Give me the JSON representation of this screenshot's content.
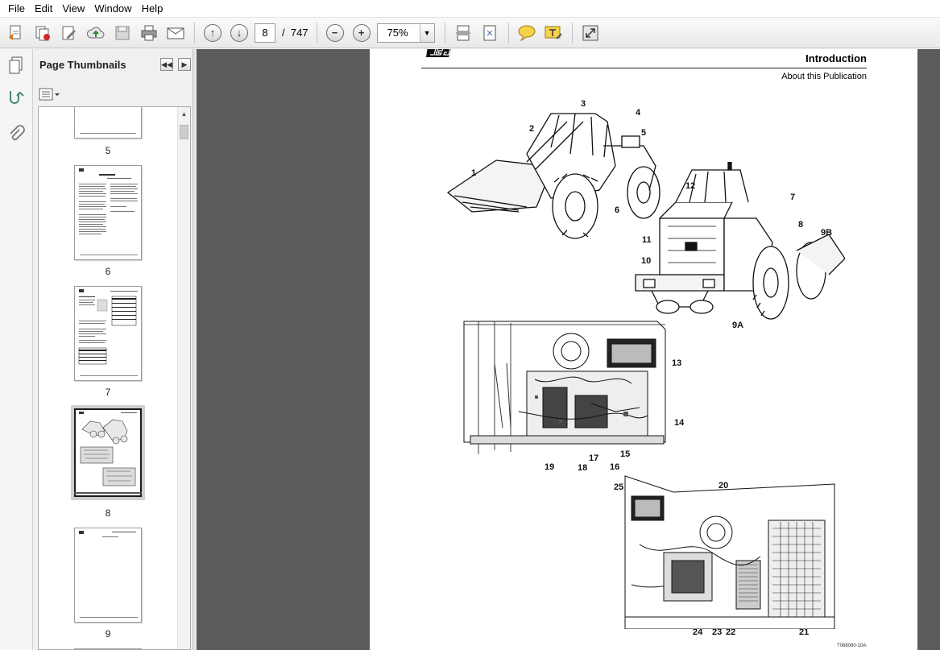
{
  "menu": [
    "File",
    "Edit",
    "View",
    "Window",
    "Help"
  ],
  "toolbar": {
    "current_page": "8",
    "page_separator": "/",
    "total_pages": "747",
    "zoom": "75%"
  },
  "panel": {
    "title": "Page Thumbnails"
  },
  "thumbnails": [
    {
      "label": "5"
    },
    {
      "label": "6"
    },
    {
      "label": "7"
    },
    {
      "label": "8"
    },
    {
      "label": "9"
    }
  ],
  "document": {
    "heading": "Introduction",
    "subheading": "About this Publication",
    "figure_code": "T068060-10A",
    "callouts": [
      "1",
      "2",
      "3",
      "4",
      "5",
      "6",
      "7",
      "8",
      "9A",
      "9B",
      "10",
      "11",
      "12",
      "13",
      "14",
      "15",
      "16",
      "17",
      "18",
      "19",
      "20",
      "21",
      "22",
      "23",
      "24",
      "25"
    ]
  },
  "colors": {
    "doc_background": "#5b5b5b",
    "selected_thumb": "#cfcfcf"
  }
}
